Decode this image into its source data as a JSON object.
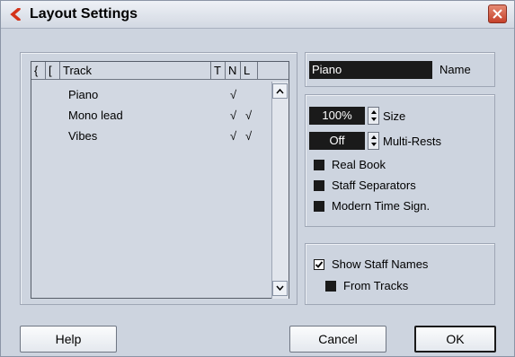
{
  "window": {
    "title": "Layout Settings"
  },
  "track_list": {
    "columns": [
      "{",
      "[",
      "Track",
      "T",
      "N",
      "L"
    ],
    "rows": [
      {
        "track": "Piano",
        "t": "",
        "n": "√",
        "l": ""
      },
      {
        "track": "Mono lead",
        "t": "",
        "n": "√",
        "l": "√"
      },
      {
        "track": "Vibes",
        "t": "",
        "n": "√",
        "l": "√"
      }
    ]
  },
  "name": {
    "value": "Piano",
    "label": "Name"
  },
  "options": {
    "size": {
      "value": "100%",
      "label": "Size"
    },
    "multi_rests": {
      "value": "Off",
      "label": "Multi-Rests"
    },
    "real_book": {
      "label": "Real Book",
      "checked": false
    },
    "staff_separators": {
      "label": "Staff Separators",
      "checked": false
    },
    "modern_time_sign": {
      "label": "Modern Time Sign.",
      "checked": false
    }
  },
  "staff_names": {
    "show": {
      "label": "Show Staff Names",
      "checked": true
    },
    "from_tracks": {
      "label": "From Tracks",
      "checked": false
    }
  },
  "buttons": {
    "help": "Help",
    "cancel": "Cancel",
    "ok": "OK"
  },
  "colors": {
    "background": "#cdd4df",
    "field": "#1a1a1a",
    "close": "#c6412a",
    "accent": "#d4331a"
  }
}
